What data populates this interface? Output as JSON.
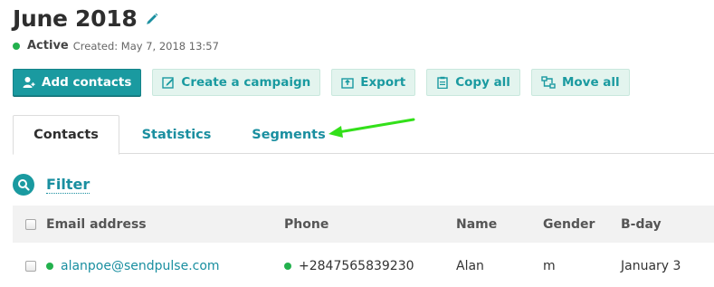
{
  "header": {
    "title": "June 2018",
    "status": "Active",
    "created": "Created: May 7, 2018 13:57"
  },
  "toolbar": {
    "add_contacts": "Add contacts",
    "create_campaign": "Create a campaign",
    "export": "Export",
    "copy_all": "Copy all",
    "move_all": "Move all"
  },
  "tabs": {
    "contacts": "Contacts",
    "statistics": "Statistics",
    "segments": "Segments"
  },
  "filter": {
    "label": "Filter"
  },
  "table": {
    "columns": [
      "Email address",
      "Phone",
      "Name",
      "Gender",
      "B-day"
    ],
    "rows": [
      {
        "email": "alanpoe@sendpulse.com",
        "phone": "+2847565839230",
        "name": "Alan",
        "gender": "m",
        "bday": "January 3"
      }
    ]
  },
  "colors": {
    "accent": "#1a9aa0",
    "active_dot": "#23b14d",
    "annotation_arrow": "#33e01a"
  }
}
